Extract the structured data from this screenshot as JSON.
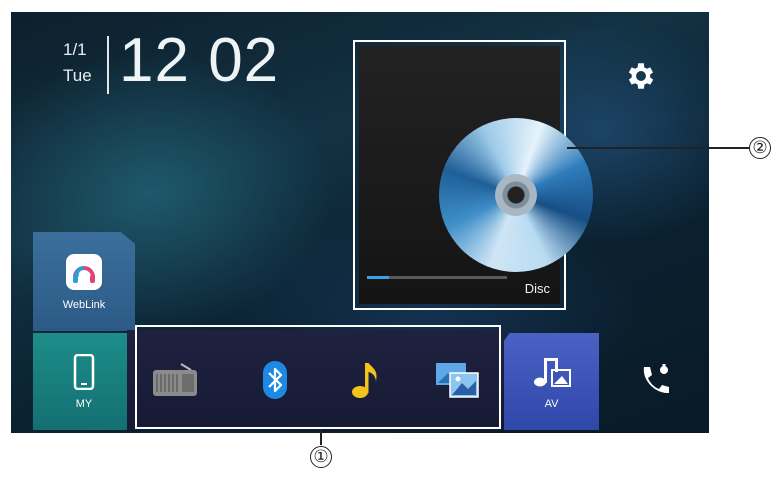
{
  "status": {
    "date": "1/1",
    "weekday": "Tue",
    "time": "12 02"
  },
  "now_playing": {
    "source_label": "Disc",
    "progress": 0.16
  },
  "tiles": {
    "weblink_label": "WebLink",
    "my_label": "MY",
    "av_label": "AV"
  },
  "shortcuts": [
    {
      "name": "radio-icon"
    },
    {
      "name": "bluetooth-icon"
    },
    {
      "name": "music-note-icon"
    },
    {
      "name": "photo-icon"
    }
  ],
  "callouts": {
    "shortcut_bar": "①",
    "album_art": "②"
  },
  "colors": {
    "bluetooth": "#1e88e5",
    "music_note": "#f4c21d",
    "my_tile": "#167c7c",
    "av_tile": "#3a55b8"
  }
}
